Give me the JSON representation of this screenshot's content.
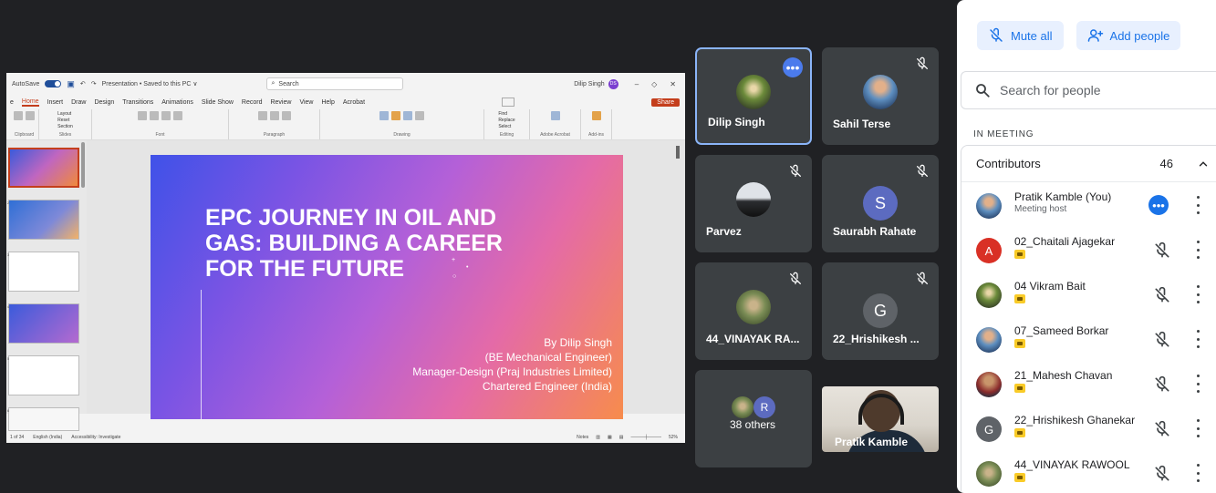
{
  "presentation": {
    "qat": {
      "autosave": "AutoSave",
      "title": "Presentation • Saved to this PC ∨",
      "search": "Search",
      "user": "Dilip Singh",
      "user_initials": "DS"
    },
    "menu": [
      "e",
      "Home",
      "Insert",
      "Draw",
      "Design",
      "Transitions",
      "Animations",
      "Slide Show",
      "Record",
      "Review",
      "View",
      "Help",
      "Acrobat"
    ],
    "share_label": "Share",
    "ribbon_groups": [
      "Clipboard",
      "Slides",
      "Font",
      "Paragraph",
      "Drawing",
      "Editing",
      "Adobe Acrobat",
      "Add-ins"
    ],
    "ribbon_items": {
      "layout": "Layout",
      "reset": "Reset",
      "new_slide": "New Slide",
      "section": "Section",
      "find": "Find",
      "replace": "Replace",
      "select": "Select",
      "create_share_pdf": "Create and Share Adobe PDF",
      "arrange": "Arrange",
      "addins": "Add-ins"
    },
    "slide": {
      "title": "EPC JOURNEY IN OIL AND GAS: BUILDING A CAREER FOR THE FUTURE",
      "author_lines": [
        "By Dilip Singh",
        "(BE Mechanical Engineer)",
        "Manager-Design (Praj Industries Limited)",
        "Chartered Engineer (India)"
      ]
    },
    "thumbnails": [
      "1",
      "2",
      "3",
      "4",
      "5",
      "6"
    ],
    "status": {
      "slide_of": "1 of 34",
      "language": "English (India)",
      "accessibility": "Accessibility: Investigate",
      "notes": "Notes",
      "zoom": "52%"
    }
  },
  "tiles": [
    {
      "name": "Dilip Singh",
      "type": "photo",
      "speaking": true
    },
    {
      "name": "Sahil Terse",
      "type": "photo",
      "muted": true
    },
    {
      "name": "Parvez",
      "type": "photo",
      "muted": true
    },
    {
      "name": "Saurabh Rahate",
      "type": "letter",
      "letter": "S",
      "color": "#5c6bc0",
      "muted": true
    },
    {
      "name": "44_VINAYAK RA...",
      "type": "photo",
      "muted": true
    },
    {
      "name": "22_Hrishikesh ...",
      "type": "letter",
      "letter": "G",
      "color": "#5f6368",
      "muted": true
    },
    {
      "name": "38 others",
      "type": "others",
      "letter": "R",
      "color": "#5c6bc0"
    },
    {
      "name": "Pratik Kamble",
      "type": "video"
    }
  ],
  "panel": {
    "mute_all": "Mute all",
    "add_people": "Add people",
    "search_placeholder": "Search for people",
    "section_label": "IN MEETING",
    "contributors_label": "Contributors",
    "contributors_count": "46",
    "people": [
      {
        "name": "Pratik Kamble (You)",
        "sub": "Meeting host",
        "avatar": "photo",
        "state": "more"
      },
      {
        "name": "02_Chaitali Ajagekar",
        "avatar": "letter",
        "letter": "A",
        "color": "#d93025",
        "state": "muted"
      },
      {
        "name": "04 Vikram Bait",
        "avatar": "photo",
        "state": "muted"
      },
      {
        "name": "07_Sameed Borkar",
        "avatar": "photo",
        "state": "muted"
      },
      {
        "name": "21_Mahesh Chavan",
        "avatar": "photo",
        "state": "muted"
      },
      {
        "name": "22_Hrishikesh Ghanekar",
        "avatar": "letter",
        "letter": "G",
        "color": "#5f6368",
        "state": "muted"
      },
      {
        "name": "44_VINAYAK RAWOOL",
        "avatar": "photo",
        "state": "muted"
      }
    ]
  }
}
